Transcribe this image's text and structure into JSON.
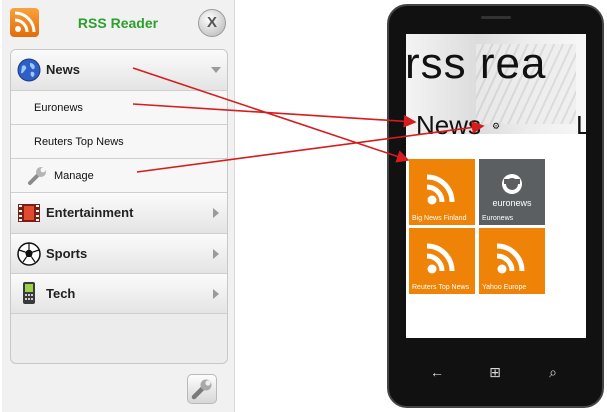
{
  "app": {
    "title": "RSS Reader",
    "close_label": "X"
  },
  "menu": {
    "items": [
      {
        "label": "News",
        "type": "category",
        "expanded": true,
        "icon": "globe-icon"
      },
      {
        "label": "Euronews",
        "type": "feed"
      },
      {
        "label": "Reuters Top News",
        "type": "feed"
      },
      {
        "label": "Manage",
        "type": "manage",
        "icon": "wrench-icon"
      },
      {
        "label": "Entertainment",
        "type": "category",
        "icon": "film-icon"
      },
      {
        "label": "Sports",
        "type": "category",
        "icon": "soccer-ball-icon"
      },
      {
        "label": "Tech",
        "type": "category",
        "icon": "phone-device-icon"
      }
    ]
  },
  "footer": {
    "settings_icon": "wrench-icon"
  },
  "phone": {
    "title": "rss rea",
    "pivot_active": "News",
    "pivot_next": "L",
    "pivot_settings_icon": "gear-icon",
    "tiles": [
      {
        "label": "Big News Finland",
        "color": "#ef8307",
        "icon": "rss-icon"
      },
      {
        "label": "Euronews",
        "color": "#5b5f61",
        "icon": "euronews-logo"
      },
      {
        "label": "Reuters Top News",
        "color": "#ef8307",
        "icon": "rss-icon"
      },
      {
        "label": "Yahoo Europe",
        "color": "#ef8307",
        "icon": "rss-icon"
      }
    ],
    "softkeys": [
      "back-icon",
      "windows-start-icon",
      "search-icon"
    ],
    "softkey_glyphs": [
      "←",
      "⊞",
      "⌕"
    ]
  },
  "colors": {
    "title_green": "#2ca02c",
    "rss_orange": "#ef8307",
    "arrow_red": "#d61c1c"
  }
}
